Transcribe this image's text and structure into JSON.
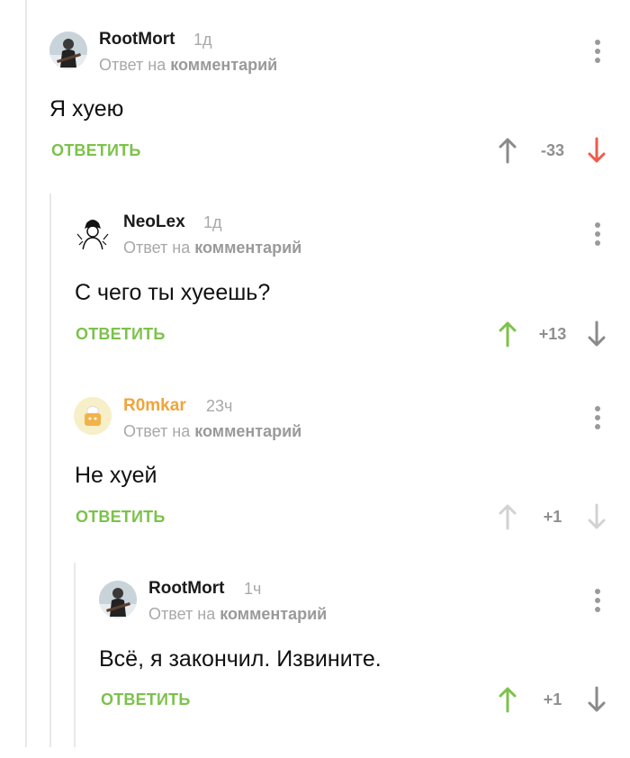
{
  "comments": [
    {
      "author": "RootMort",
      "time": "1д",
      "reply_prefix": "Ответ на",
      "reply_target": "комментарий",
      "text": "Я хуею",
      "reply_label": "ОТВЕТИТЬ",
      "votes": "-33",
      "author_color": "#1a1a1a",
      "up_color": "#8a8a8a",
      "down_color": "#ef5b4a",
      "avatar_icon": "guitarist-avatar-icon"
    },
    {
      "author": "NeoLex",
      "time": "1д",
      "reply_prefix": "Ответ на",
      "reply_target": "комментарий",
      "text": "С чего ты хуеешь?",
      "reply_label": "ОТВЕТИТЬ",
      "votes": "+13",
      "author_color": "#1a1a1a",
      "up_color": "#7cc24b",
      "down_color": "#8a8a8a",
      "avatar_icon": "sketch-avatar-icon"
    },
    {
      "author": "R0mkar",
      "time": "23ч",
      "reply_prefix": "Ответ на",
      "reply_target": "комментарий",
      "text": "Не хуей",
      "reply_label": "ОТВЕТИТЬ",
      "votes": "+1",
      "author_color": "#f0a43a",
      "up_color": "#cfcfcf",
      "down_color": "#cfcfcf",
      "avatar_icon": "default-avatar-icon"
    },
    {
      "author": "RootMort",
      "time": "1ч",
      "reply_prefix": "Ответ на",
      "reply_target": "комментарий",
      "text": "Всё, я закончил. Извините.",
      "reply_label": "ОТВЕТИТЬ",
      "votes": "+1",
      "author_color": "#1a1a1a",
      "up_color": "#7cc24b",
      "down_color": "#8a8a8a",
      "avatar_icon": "guitarist-avatar-icon"
    }
  ]
}
